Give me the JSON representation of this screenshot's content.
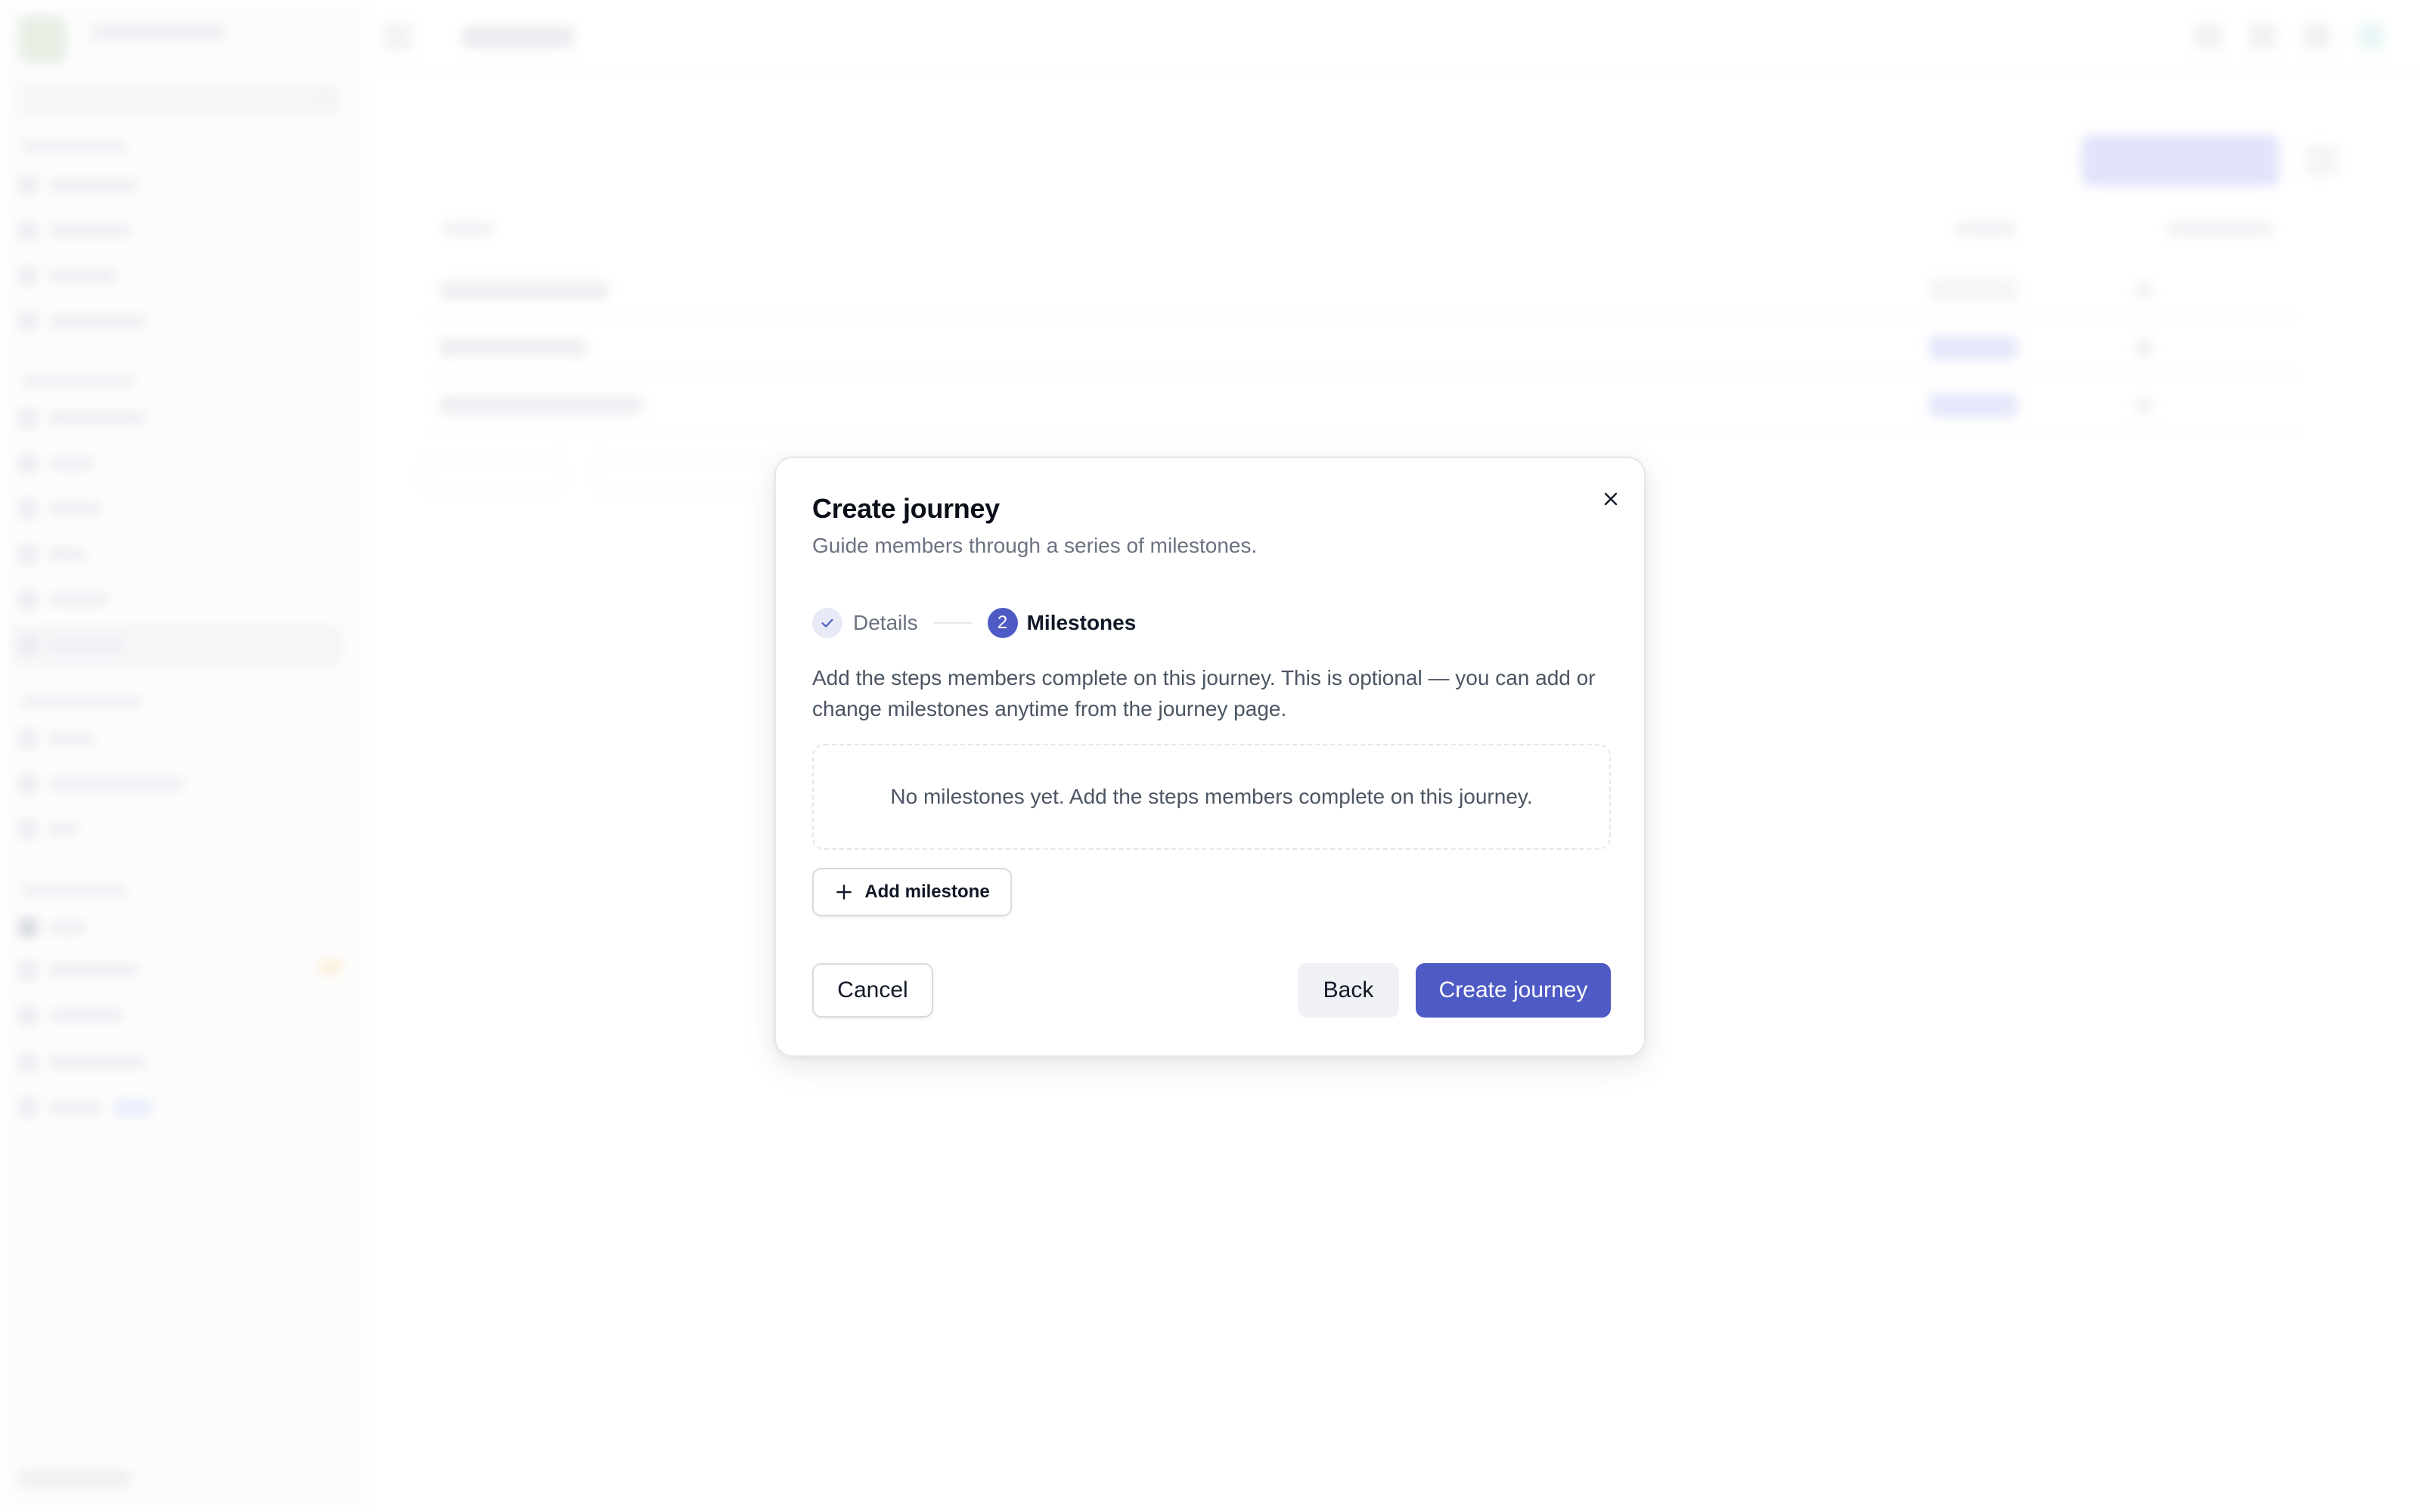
{
  "modal": {
    "title": "Create journey",
    "subtitle": "Guide members through a series of milestones.",
    "close_icon": "close-icon",
    "steps": [
      {
        "label": "Details",
        "state": "completed",
        "icon": "check-icon"
      },
      {
        "number": "2",
        "label": "Milestones",
        "state": "current"
      }
    ],
    "description": "Add the steps members complete on this journey. This is optional — you can add or change milestones anytime from the journey page.",
    "empty_state": "No milestones yet. Add the steps members complete on this journey.",
    "add_milestone_label": "Add milestone",
    "add_icon": "plus-icon",
    "cancel_label": "Cancel",
    "back_label": "Back",
    "create_label": "Create journey"
  },
  "colors": {
    "primary": "#4f5bc4",
    "step_done_bg": "#e7e9f7",
    "text_muted": "#6b7280"
  }
}
